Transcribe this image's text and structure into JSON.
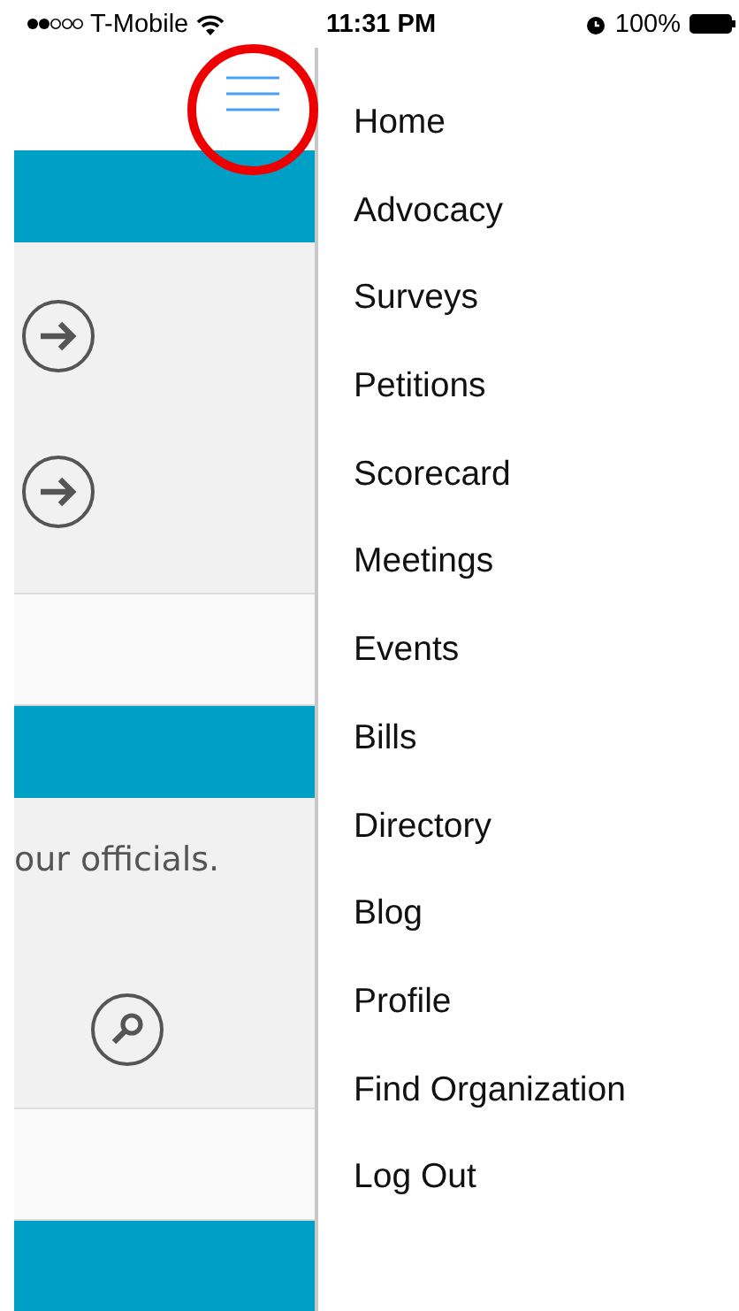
{
  "status_bar": {
    "carrier": "T-Mobile",
    "time": "11:31 PM",
    "battery": "100%"
  },
  "content_sections": [
    {
      "kind": "bar"
    },
    {
      "kind": "arrow-panel"
    },
    {
      "kind": "spacer"
    },
    {
      "kind": "bar"
    },
    {
      "kind": "search-panel",
      "text": "our officials."
    },
    {
      "kind": "spacer"
    },
    {
      "kind": "bar"
    }
  ],
  "menu": {
    "items": [
      "Home",
      "Advocacy",
      "Surveys",
      "Petitions",
      "Scorecard",
      "Meetings",
      "Events",
      "Bills",
      "Directory",
      "Blog",
      "Profile",
      "Find Organization",
      "Log Out"
    ]
  }
}
